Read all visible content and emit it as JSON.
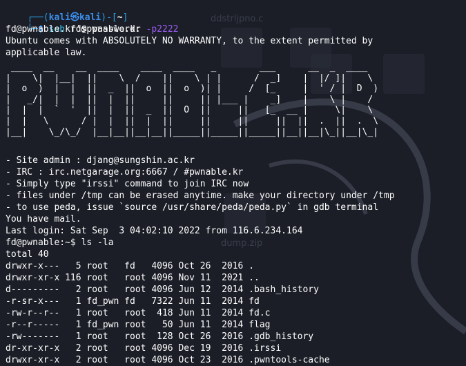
{
  "prompt": {
    "corner_top": "┌──(",
    "user": "kali",
    "skull": "㉿",
    "host": "kali",
    "dir_open": ")-[",
    "dir": "~",
    "dir_close": "]",
    "corner_bottom": "└─",
    "symbol": "$",
    "cmd": "ssh",
    "target": "fd@pwnable.kr",
    "port_flag": "-p2222"
  },
  "output": {
    "password": "fd@pwnable.kr's password:",
    "warranty_1": "Ubuntu comes with ABSOLUTELY NO WARRANTY, to the extent permitted by",
    "warranty_2": "applicable law.",
    "banner": " ____  __    __  ____    ____  ____   _        ___      __  _  ____  \n|    \\|  |__|  ||    \\  /    ||    \\ | |      /  _]    |  |/ ]|    \\ \n|  o  )  |  |  ||  _  ||  o  ||  o  )| |     /  [_     |  ' / |  D  )\n|   _/|  |  |  ||  |  ||     ||     || |___ |    _]    |    \\ |    / \n|  |  |  `  '  ||  |  ||  _  ||  O  ||     ||   [_  __ |     \\|    \\ \n|  |   \\      / |  |  ||  |  ||     ||     ||     ||  ||  .  ||  .  \\\n|__|    \\_/\\_/  |__|__||__|__||_____||_____||_____||__||__|\\_||__|\\_|",
    "info_1": "- Site admin : djang@sungshin.ac.kr",
    "info_2": "- IRC : irc.netgarage.org:6667 / #pwnable.kr",
    "info_3": "- Simply type \"irssi\" command to join IRC now",
    "info_4": "- files under /tmp can be erased anytime. make your directory under /tmp",
    "info_5": "- to use peda, issue `source /usr/share/peda/peda.py` in gdb terminal",
    "mail": "You have mail.",
    "last_login": "Last login: Sat Sep  3 04:02:10 2022 from 116.6.234.164",
    "prompt2": "fd@pwnable:~$ ls -la",
    "total": "total 40"
  },
  "listing": [
    "drwxr-x---   5 root   fd   4096 Oct 26  2016 .",
    "drwxr-xr-x 116 root   root 4096 Nov 11  2021 ..",
    "d---------   2 root   root 4096 Jun 12  2014 .bash_history",
    "-r-sr-x---   1 fd_pwn fd   7322 Jun 11  2014 fd",
    "-rw-r--r--   1 root   root  418 Jun 11  2014 fd.c",
    "-r--r-----   1 fd_pwn root   50 Jun 11  2014 flag",
    "-rw-------   1 root   root  128 Oct 26  2016 .gdb_history",
    "dr-xr-xr-x   2 root   root 4096 Dec 19  2016 .irssi",
    "drwxr-xr-x   2 root   root 4096 Oct 23  2016 .pwntools-cache"
  ],
  "background": {
    "file1": "ddstrljpno.c",
    "file2": "dump.zip"
  },
  "colors": {
    "background": "#1b1e27",
    "prompt_blue": "#2aa0e6",
    "command_cyan": "#31c8f0",
    "arg_purple": "#9e5cf6"
  }
}
